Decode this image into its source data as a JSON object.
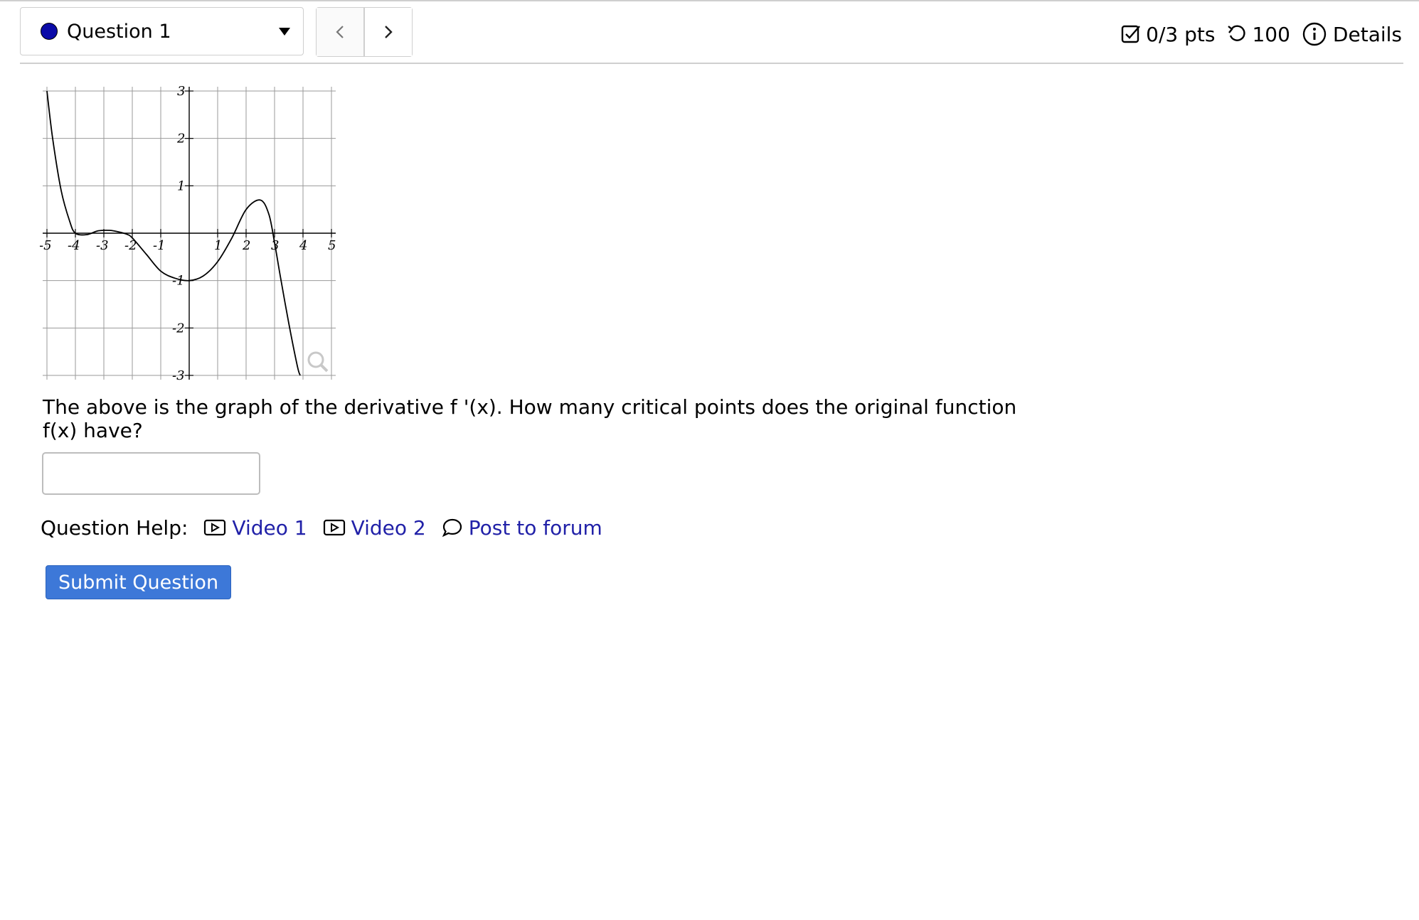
{
  "question_select": {
    "label": "Question 1",
    "status_color": "#0b0ba8"
  },
  "nav": {
    "prev_icon": "chevron-left-icon",
    "next_icon": "chevron-right-icon"
  },
  "status": {
    "score": "0/3 pts",
    "attempts": "100",
    "details": "Details"
  },
  "chart_data": {
    "type": "line",
    "title": "",
    "xlabel": "",
    "ylabel": "",
    "xlim": [
      -5,
      5
    ],
    "ylim": [
      -3,
      3
    ],
    "x_tick_labels": [
      "-5",
      "-4",
      "-3",
      "-2",
      "-1",
      "1",
      "2",
      "3",
      "4",
      "5"
    ],
    "y_tick_labels": [
      "3",
      "2",
      "1",
      "-1",
      "-2",
      "-3"
    ],
    "grid": true,
    "series": [
      {
        "x": [
          -5.0,
          -4.8,
          -4.5,
          -4.2,
          -4.0,
          -3.6,
          -3.2,
          -2.8,
          -2.5,
          -2.2,
          -2.0,
          -1.5,
          -1.0,
          -0.5,
          0.0,
          0.5,
          1.0,
          1.5,
          2.0,
          2.5,
          2.8,
          3.0,
          3.2,
          3.5,
          3.8,
          3.9
        ],
        "y": [
          3.0,
          2.0,
          0.9,
          0.25,
          0.0,
          -0.03,
          0.05,
          0.06,
          0.03,
          -0.02,
          -0.1,
          -0.45,
          -0.8,
          -0.95,
          -1.0,
          -0.9,
          -0.6,
          -0.1,
          0.5,
          0.7,
          0.4,
          -0.2,
          -0.9,
          -1.9,
          -2.8,
          -3.0
        ]
      }
    ],
    "zoom_icon": "magnifier-icon"
  },
  "prompt": "The above is the graph of the derivative f '(x). How many critical points does the original function f(x) have?",
  "answer": {
    "value": ""
  },
  "help": {
    "label": "Question Help:",
    "links": [
      {
        "label": "Video 1",
        "icon": "video-icon"
      },
      {
        "label": "Video 2",
        "icon": "video-icon"
      },
      {
        "label": "Post to forum",
        "icon": "speech-bubble-icon"
      }
    ]
  },
  "submit_label": "Submit Question",
  "colors": {
    "accent": "#3d78d8",
    "link": "#2121a8"
  }
}
